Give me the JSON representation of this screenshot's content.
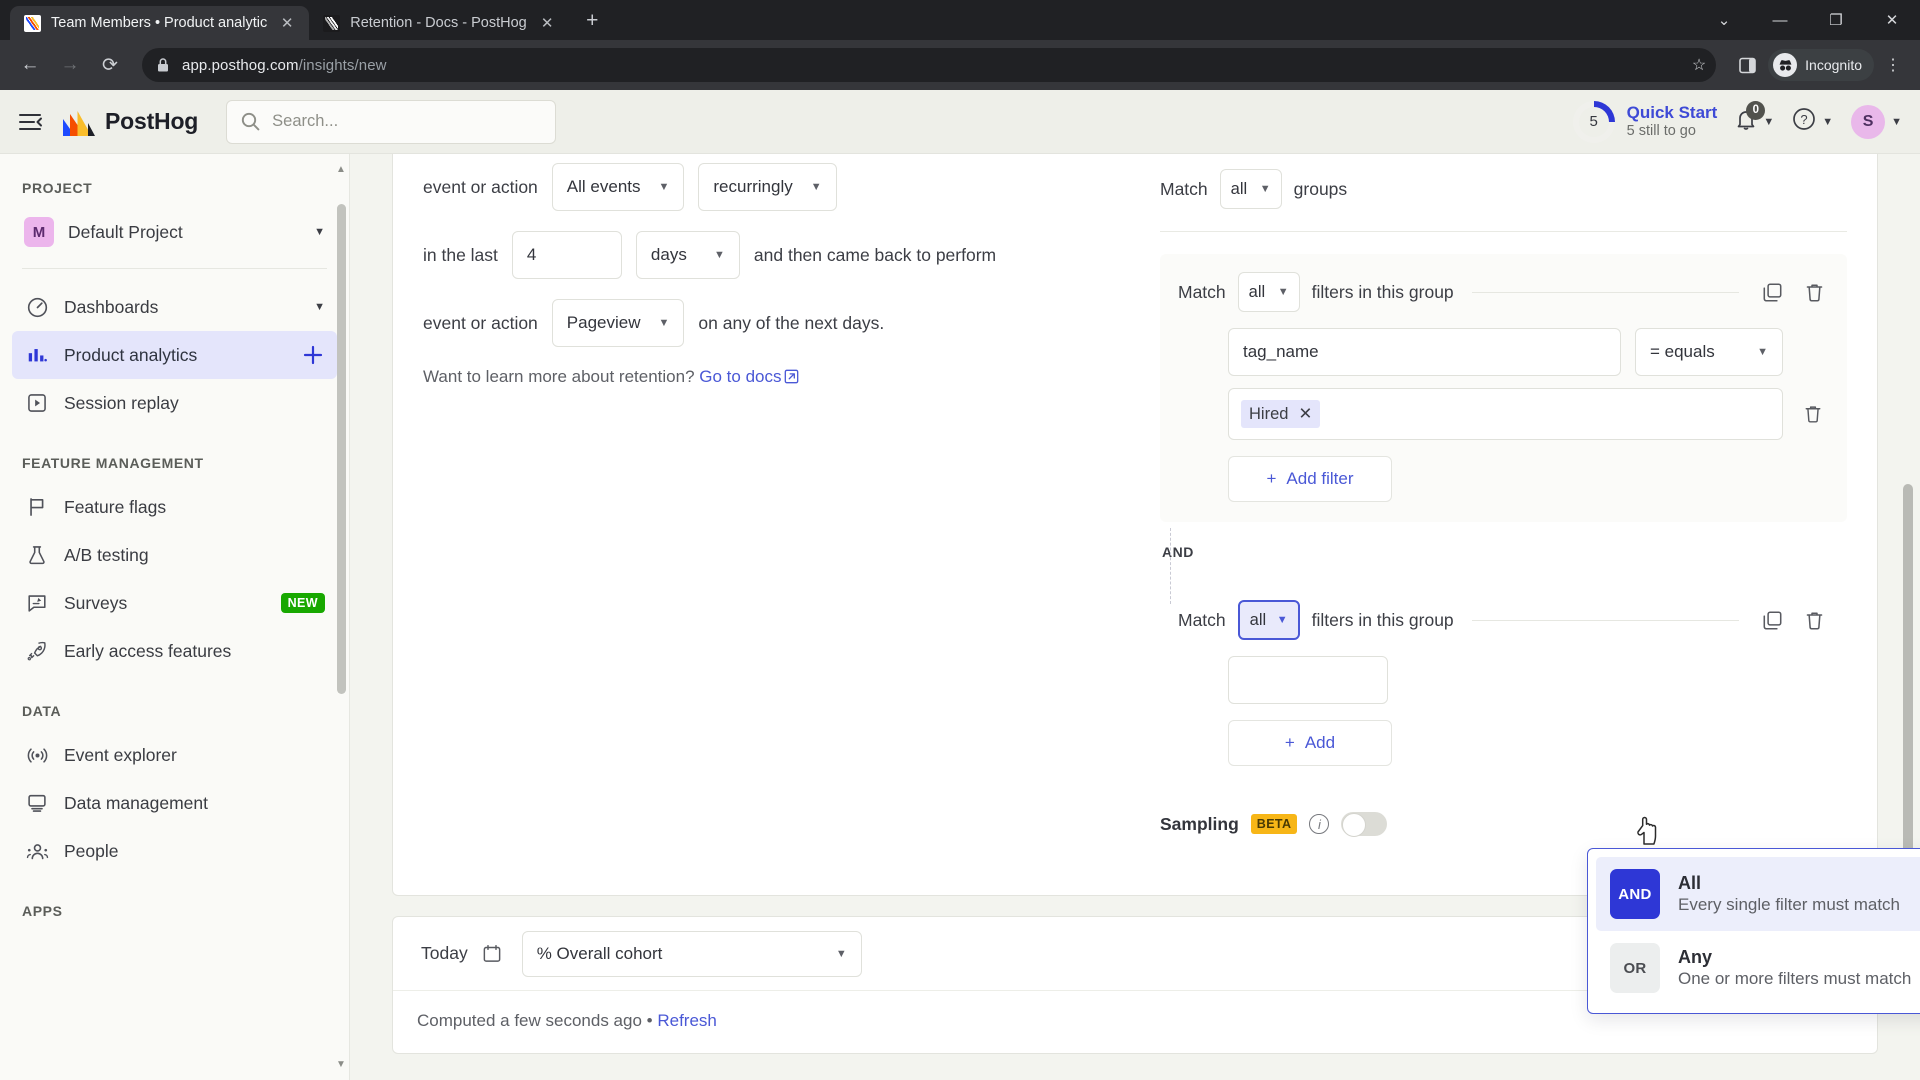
{
  "browser": {
    "tabs": [
      {
        "title": "Team Members • Product analytic",
        "close": "✕",
        "active": true,
        "favicon": "posthog-favicon"
      },
      {
        "title": "Retention - Docs - PostHog",
        "close": "✕",
        "active": false,
        "favicon": "posthog-docs-favicon"
      }
    ],
    "new_tab_label": "+",
    "window_controls": [
      "⌄",
      "—",
      "❐",
      "✕"
    ],
    "nav": {
      "back": "←",
      "forward": "→",
      "reload": "⟳"
    },
    "address": {
      "lock": "🔒",
      "host": "app.posthog.com",
      "path": "/insights/new"
    },
    "toolbar_right": {
      "star": "☆",
      "sidepanel": "▯",
      "profile_label": "Incognito",
      "menu": "⋮"
    }
  },
  "app_header": {
    "menu_toggle": "collapse-sidebar-icon",
    "brand": "PostHog",
    "search_placeholder": "Search...",
    "quick_start": {
      "count": "5",
      "title": "Quick Start",
      "subtitle": "5 still to go"
    },
    "notifications_badge": "0",
    "help_icon": "?",
    "avatar_initial": "S"
  },
  "sidebar": {
    "sections": [
      {
        "label": "PROJECT",
        "items": [
          {
            "label": "Default Project",
            "icon": "project-chip",
            "chip": "M",
            "trail": "chevron-down-icon",
            "active": false
          }
        ]
      },
      {
        "label": "",
        "items": [
          {
            "label": "Dashboards",
            "icon": "gauge-icon",
            "trail": "chevron-down-icon",
            "active": false
          },
          {
            "label": "Product analytics",
            "icon": "bar-chart-icon",
            "trail": "plus-icon",
            "active": true
          },
          {
            "label": "Session replay",
            "icon": "play-square-icon",
            "trail": "",
            "active": false
          }
        ]
      },
      {
        "label": "FEATURE MANAGEMENT",
        "items": [
          {
            "label": "Feature flags",
            "icon": "flag-icon",
            "trail": "",
            "active": false
          },
          {
            "label": "A/B testing",
            "icon": "flask-icon",
            "trail": "",
            "active": false
          },
          {
            "label": "Surveys",
            "icon": "survey-icon",
            "trail": "NEW",
            "active": false
          },
          {
            "label": "Early access features",
            "icon": "rocket-icon",
            "trail": "",
            "active": false
          }
        ]
      },
      {
        "label": "DATA",
        "items": [
          {
            "label": "Event explorer",
            "icon": "broadcast-icon",
            "trail": "",
            "active": false
          },
          {
            "label": "Data management",
            "icon": "monitor-icon",
            "trail": "",
            "active": false
          },
          {
            "label": "People",
            "icon": "people-icon",
            "trail": "",
            "active": false
          }
        ]
      },
      {
        "label": "APPS",
        "items": []
      }
    ]
  },
  "retention": {
    "row1": {
      "label": "event or action",
      "event": "All events",
      "recurrence": "recurringly"
    },
    "row2": {
      "label": "in the last",
      "value": "4",
      "unit": "days",
      "suffix": "and then came back to perform"
    },
    "row3": {
      "label": "event or action",
      "event": "Pageview",
      "suffix": "on any of the next days."
    },
    "docs": {
      "text": "Want to learn more about retention?",
      "link": "Go to docs",
      "external_icon": "external-link-icon"
    }
  },
  "filters": {
    "top_match": {
      "prefix": "Match",
      "value": "all",
      "suffix": "groups"
    },
    "groups": [
      {
        "prefix": "Match",
        "value": "all",
        "suffix": "filters in this group",
        "duplicate_icon": "duplicate-icon",
        "delete_icon": "trash-icon",
        "rows": [
          {
            "key": "tag_name",
            "operator": "= equals",
            "value_chip": "Hired",
            "chip_close": "✕"
          }
        ],
        "add_filter": {
          "plus": "+",
          "label": "Add filter"
        },
        "focused": false
      },
      {
        "prefix": "Match",
        "value": "all",
        "suffix": "filters in this group",
        "duplicate_icon": "duplicate-icon",
        "delete_icon": "trash-icon",
        "rows": [],
        "add_filter": {
          "plus": "+",
          "label": "Add"
        },
        "focused": true
      }
    ],
    "separator_label": "AND"
  },
  "match_dropdown": {
    "options": [
      {
        "badge": "AND",
        "title": "All",
        "desc": "Every single filter must match",
        "selected": true
      },
      {
        "badge": "OR",
        "title": "Any",
        "desc": "One or more filters must match",
        "selected": false
      }
    ]
  },
  "sampling": {
    "label": "Sampling",
    "badge": "BETA",
    "info_icon": "info-icon",
    "enabled": false
  },
  "bottom_bar": {
    "date_label": "Today",
    "calendar_icon": "calendar-icon",
    "cohort_value": "% Overall cohort",
    "status": "Computed a few seconds ago",
    "separator": "•",
    "refresh": "Refresh"
  },
  "colors": {
    "accent": "#4a58d6",
    "accent_strong": "#2e37d6",
    "new_badge": "#18a800",
    "beta_badge": "#f7b617",
    "avatar": "#e9b8ea"
  }
}
